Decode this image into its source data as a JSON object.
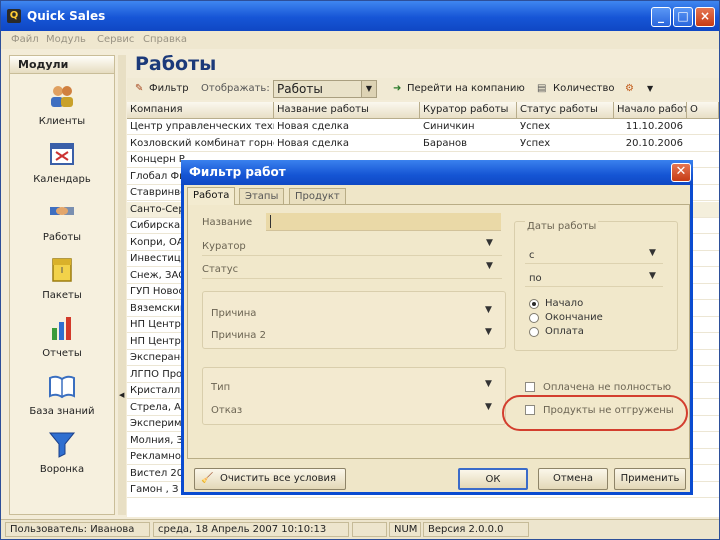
{
  "window": {
    "title": "Quick Sales",
    "minimize": "_",
    "maximize": "□",
    "close": "×"
  },
  "menu": [
    "Файл",
    "Модуль",
    "Сервис",
    "Справка"
  ],
  "sidebar": {
    "header": "Модули",
    "items": [
      {
        "label": "Клиенты",
        "icon": "clients-icon"
      },
      {
        "label": "Календарь",
        "icon": "calendar-icon"
      },
      {
        "label": "Работы",
        "icon": "handshake-icon"
      },
      {
        "label": "Пакеты",
        "icon": "package-icon"
      },
      {
        "label": "Отчеты",
        "icon": "bar-chart-icon"
      },
      {
        "label": "База знаний",
        "icon": "book-icon"
      },
      {
        "label": "Воронка",
        "icon": "funnel-icon"
      }
    ]
  },
  "page": {
    "title": "Работы"
  },
  "toolbar": {
    "filter": "Фильтр",
    "show_label": "Отображать:",
    "show_value": "Работы",
    "goto_company": "Перейти на компанию",
    "quantity": "Количество"
  },
  "grid": {
    "headers": [
      "Компания",
      "Название работы",
      "Куратор работы",
      "Статус работы",
      "Начало работ",
      "О"
    ],
    "rows": [
      [
        "Центр управленческих техн",
        "Новая сделка",
        "Синичкин",
        "Успех",
        "11.10.2006"
      ],
      [
        "Козловский комбинат горнор",
        "Новая сделка",
        "Баранов",
        "Успех",
        "20.10.2006"
      ],
      [
        "Концерн Р",
        "",
        "",
        "",
        ""
      ],
      [
        "Глобал Фи",
        "",
        "",
        "",
        ""
      ],
      [
        "Ставринве",
        "",
        "",
        "",
        ""
      ],
      [
        "Санто-Сер",
        "",
        "",
        "",
        ""
      ],
      [
        "Сибирская",
        "",
        "",
        "",
        ""
      ],
      [
        "Копри, ОА",
        "",
        "",
        "",
        ""
      ],
      [
        "Инвестиц",
        "",
        "",
        "",
        ""
      ],
      [
        "Снеж, ЗАС",
        "",
        "",
        "",
        ""
      ],
      [
        "ГУП Новос",
        "",
        "",
        "",
        ""
      ],
      [
        "Вяземский",
        "",
        "",
        "",
        ""
      ],
      [
        "НП Центр",
        "",
        "",
        "",
        ""
      ],
      [
        "НП Центр",
        "",
        "",
        "",
        ""
      ],
      [
        "Эксперанс",
        "",
        "",
        "",
        ""
      ],
      [
        "ЛГПО Прод",
        "",
        "",
        "",
        ""
      ],
      [
        "Кристалл,",
        "",
        "",
        "",
        ""
      ],
      [
        "Стрела, А",
        "",
        "",
        "",
        ""
      ],
      [
        "Эксперим",
        "",
        "",
        "",
        ""
      ],
      [
        "Молния, З",
        "",
        "",
        "",
        ""
      ],
      [
        "Рекламное",
        "",
        "",
        "",
        ""
      ],
      [
        "Вистел 20",
        "",
        "",
        "",
        ""
      ],
      [
        "Гамон , З",
        "",
        "",
        "",
        ""
      ]
    ]
  },
  "status": {
    "user": "Пользователь: Иванова",
    "datetime": "среда, 18 Апрель 2007 10:10:13",
    "num": "NUM",
    "version": "Версия 2.0.0.0"
  },
  "dialog": {
    "title": "Фильтр работ",
    "tabs": [
      "Работа",
      "Этапы",
      "Продукт"
    ],
    "fields": {
      "name": "Название",
      "curator": "Куратор",
      "status": "Статус",
      "reason": "Причина",
      "reason2": "Причина 2",
      "type": "Тип",
      "refusal": "Отказ"
    },
    "dates": {
      "title": "Даты работы",
      "from": "с",
      "to": "по",
      "radio": [
        "Начало",
        "Окончание",
        "Оплата"
      ]
    },
    "checks": [
      "Оплачена не полностью",
      "Продукты не отгружены"
    ],
    "buttons": {
      "clear": "Очистить все условия",
      "ok": "ОК",
      "cancel": "Отмена",
      "apply": "Применить"
    }
  }
}
